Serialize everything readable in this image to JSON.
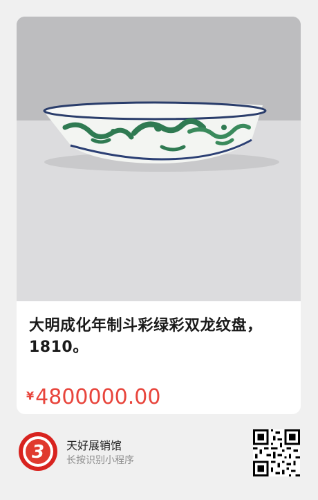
{
  "product": {
    "title": "大明成化年制斗彩绿彩双龙纹盘，1810。",
    "currency": "¥",
    "price": "4800000.00",
    "image_icon": "porcelain-plate-photo"
  },
  "shop": {
    "name": "天好展销馆",
    "hint": "长按识别小程序",
    "logo_icon": "shop-logo-icon",
    "qr_icon": "qr-code-icon"
  },
  "colors": {
    "price": "#e8453c",
    "logo_red": "#d8231f",
    "page_bg": "#f0f0f0"
  }
}
